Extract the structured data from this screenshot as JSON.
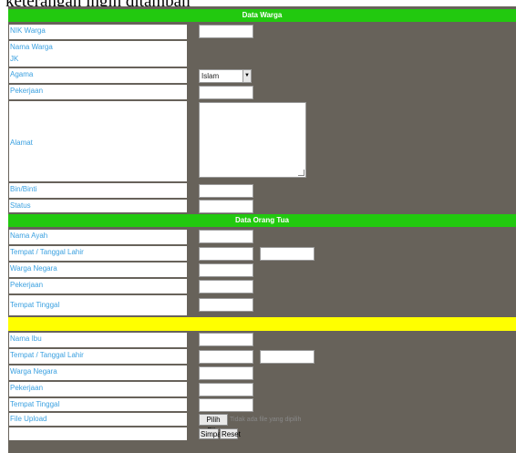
{
  "page": {
    "top_title": "keterangan ingin ditambah"
  },
  "section_warga": {
    "title": "Data Warga",
    "fields": {
      "nik": "NIK Warga",
      "nama": "Nama Warga",
      "jk": "JK",
      "agama": "Agama",
      "agama_value": "Islam",
      "pekerjaan": "Pekerjaan",
      "alamat": "Alamat",
      "bin_binti": "Bin/Binti",
      "status": "Status"
    }
  },
  "section_ortu": {
    "title": "Data Orang Tua",
    "ayah": {
      "nama": "Nama Ayah",
      "ttl": "Tempat / Tanggal Lahir",
      "warga_negara": "Warga Negara",
      "pekerjaan": "Pekerjaan",
      "tempat_tinggal": "Tempat Tinggal"
    },
    "ibu": {
      "nama": "Nama Ibu",
      "ttl": "Tempat / Tanggal Lahir",
      "warga_negara": "Warga Negara",
      "pekerjaan": "Pekerjaan",
      "tempat_tinggal": "Tempat Tinggal"
    }
  },
  "upload": {
    "label": "File Upload",
    "button": "Pilih File",
    "note": "Tidak ada file yang dipilih"
  },
  "actions": {
    "save": "Simpan",
    "reset": "Reset"
  },
  "colors": {
    "section_green": "#22c90f",
    "separator_yellow": "#ffff00",
    "panel_gray": "#67625a",
    "label_blue": "#3aa0e0"
  }
}
